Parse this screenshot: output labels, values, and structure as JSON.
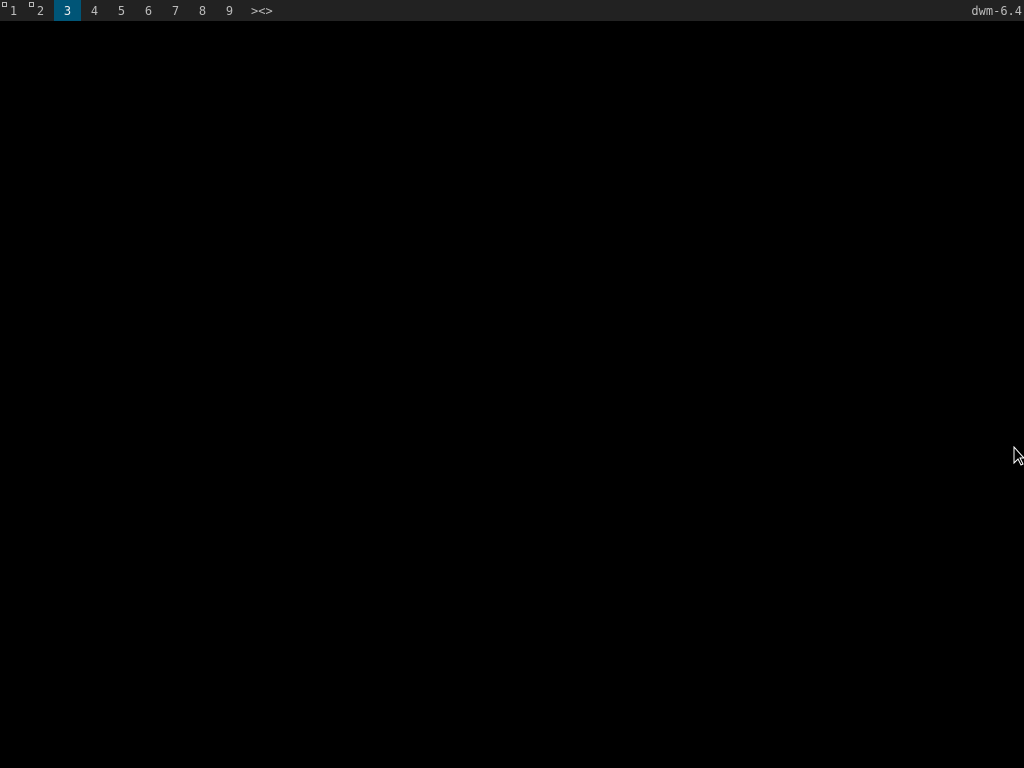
{
  "bar": {
    "tags": [
      {
        "label": "1",
        "occupied": true,
        "selected": false
      },
      {
        "label": "2",
        "occupied": true,
        "selected": false
      },
      {
        "label": "3",
        "occupied": false,
        "selected": true
      },
      {
        "label": "4",
        "occupied": false,
        "selected": false
      },
      {
        "label": "5",
        "occupied": false,
        "selected": false
      },
      {
        "label": "6",
        "occupied": false,
        "selected": false
      },
      {
        "label": "7",
        "occupied": false,
        "selected": false
      },
      {
        "label": "8",
        "occupied": false,
        "selected": false
      },
      {
        "label": "9",
        "occupied": false,
        "selected": false
      }
    ],
    "layout_symbol": "><>",
    "status_text": "dwm-6.4"
  },
  "colors": {
    "bar_bg": "#222222",
    "bar_fg": "#bbbbbb",
    "selected_bg": "#005577",
    "selected_fg": "#eeeeee",
    "desktop_bg": "#000000"
  },
  "cursor": {
    "icon": "arrow-pointer-icon"
  }
}
